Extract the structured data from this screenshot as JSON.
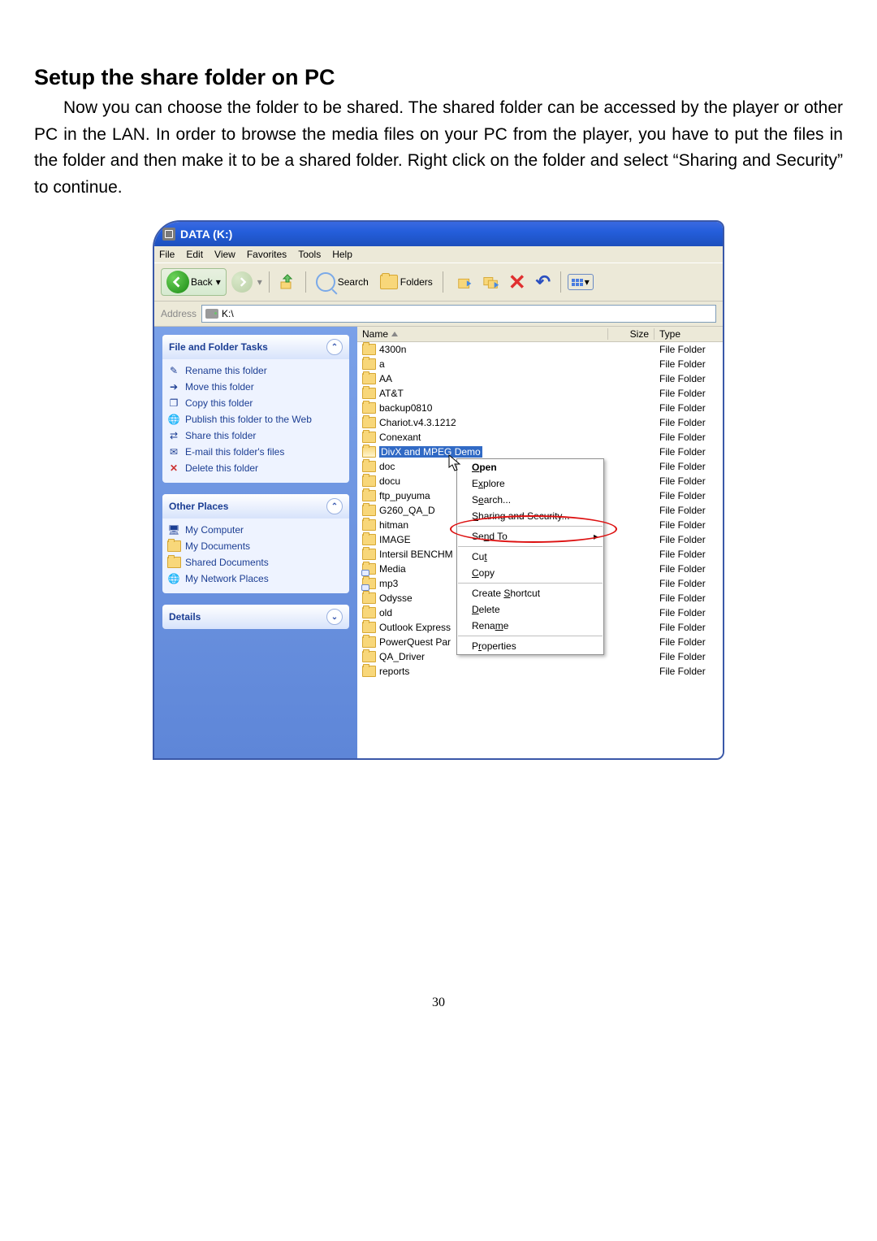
{
  "doc": {
    "section_title": "Setup the share folder on PC",
    "paragraph": "Now you can choose the folder to be shared. The shared folder can be accessed by the player or other PC in the LAN. In order to browse the media files on your PC from the player, you have to put the files in the folder and then make it to be a shared folder. Right click on the folder and select “Sharing and Security” to continue.",
    "page_number": "30"
  },
  "window": {
    "title": "DATA (K:)",
    "menus": [
      "File",
      "Edit",
      "View",
      "Favorites",
      "Tools",
      "Help"
    ],
    "toolbar": {
      "back": "Back",
      "search": "Search",
      "folders": "Folders"
    },
    "address_label": "Address",
    "address_value": "K:\\",
    "columns": {
      "name": "Name",
      "size": "Size",
      "type": "Type"
    },
    "sidepanel": {
      "tasks_header": "File and Folder Tasks",
      "tasks": [
        "Rename this folder",
        "Move this folder",
        "Copy this folder",
        "Publish this folder to the Web",
        "Share this folder",
        "E-mail this folder's files",
        "Delete this folder"
      ],
      "places_header": "Other Places",
      "places": [
        "My Computer",
        "My Documents",
        "Shared Documents",
        "My Network Places"
      ],
      "details_header": "Details"
    },
    "type_label": "File Folder",
    "folders": [
      "4300n",
      "a",
      "AA",
      "AT&T",
      "backup0810",
      "Chariot.v4.3.1212",
      "Conexant",
      "DivX and MPEG Demo",
      "doc",
      "docu",
      "ftp_puyuma",
      "G260_QA_D",
      "hitman",
      "IMAGE",
      "Intersil BENCHM",
      "Media",
      "mp3",
      "Odysse",
      "old",
      "Outlook Express",
      "PowerQuest Par",
      "QA_Driver",
      "reports"
    ],
    "selected_index": 7,
    "context_menu": {
      "open": "Open",
      "explore": "Explore",
      "search": "Search...",
      "sharing": "Sharing and Security...",
      "sendto": "Send To",
      "cut": "Cut",
      "copy": "Copy",
      "shortcut": "Create Shortcut",
      "delete": "Delete",
      "rename": "Rename",
      "properties": "Properties"
    }
  }
}
